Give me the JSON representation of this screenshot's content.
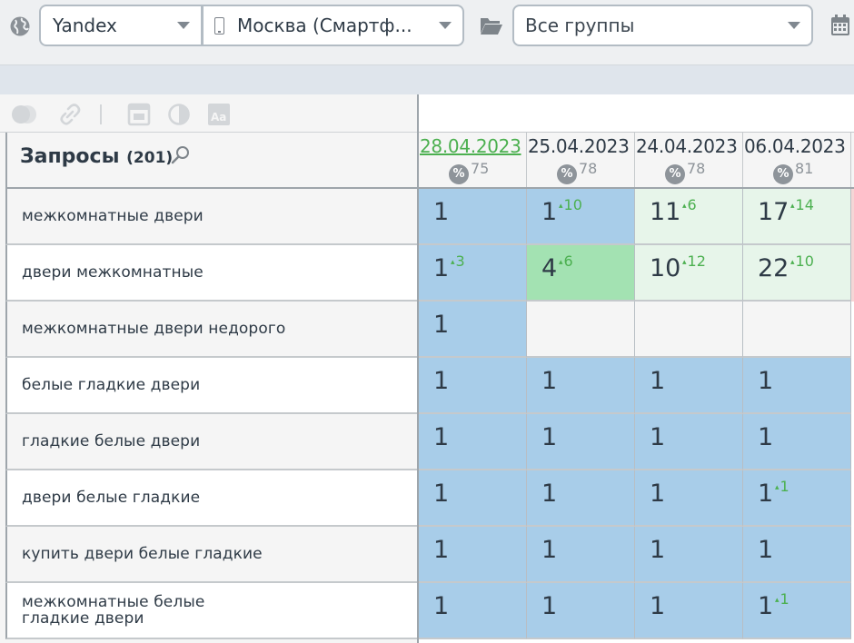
{
  "toolbar": {
    "search_engine": "Yandex",
    "region": "Москва (Смартф...",
    "group": "Все группы"
  },
  "queries": {
    "title": "Запросы",
    "count": "(201)"
  },
  "columns": [
    {
      "date": "28.04.2023",
      "metric": "75",
      "active": true
    },
    {
      "date": "25.04.2023",
      "metric": "78",
      "active": false
    },
    {
      "date": "24.04.2023",
      "metric": "78",
      "active": false
    },
    {
      "date": "06.04.2023",
      "metric": "81",
      "active": false
    }
  ],
  "percent_symbol": "%",
  "rows": [
    {
      "query": "межкомнатные двери",
      "cells": [
        {
          "value": "1",
          "delta": "",
          "color": "blue"
        },
        {
          "value": "1",
          "delta": "10",
          "color": "blue"
        },
        {
          "value": "11",
          "delta": "6",
          "color": "lightgreen"
        },
        {
          "value": "17",
          "delta": "14",
          "color": "lightgreen"
        }
      ]
    },
    {
      "query": "двери межкомнатные",
      "cells": [
        {
          "value": "1",
          "delta": "3",
          "color": "blue"
        },
        {
          "value": "4",
          "delta": "6",
          "color": "green"
        },
        {
          "value": "10",
          "delta": "12",
          "color": "lightgreen"
        },
        {
          "value": "22",
          "delta": "10",
          "color": "lightgreen"
        }
      ]
    },
    {
      "query": "межкомнатные двери недорого",
      "cells": [
        {
          "value": "1",
          "delta": "",
          "color": "blue"
        },
        {
          "value": "",
          "delta": "",
          "color": "white"
        },
        {
          "value": "",
          "delta": "",
          "color": "white"
        },
        {
          "value": "",
          "delta": "",
          "color": "white"
        }
      ]
    },
    {
      "query": "белые гладкие двери",
      "cells": [
        {
          "value": "1",
          "delta": "",
          "color": "blue"
        },
        {
          "value": "1",
          "delta": "",
          "color": "blue"
        },
        {
          "value": "1",
          "delta": "",
          "color": "blue"
        },
        {
          "value": "1",
          "delta": "",
          "color": "blue"
        }
      ]
    },
    {
      "query": "гладкие белые двери",
      "cells": [
        {
          "value": "1",
          "delta": "",
          "color": "blue"
        },
        {
          "value": "1",
          "delta": "",
          "color": "blue"
        },
        {
          "value": "1",
          "delta": "",
          "color": "blue"
        },
        {
          "value": "1",
          "delta": "",
          "color": "blue"
        }
      ]
    },
    {
      "query": "двери белые гладкие",
      "cells": [
        {
          "value": "1",
          "delta": "",
          "color": "blue"
        },
        {
          "value": "1",
          "delta": "",
          "color": "blue"
        },
        {
          "value": "1",
          "delta": "",
          "color": "blue"
        },
        {
          "value": "1",
          "delta": "1",
          "color": "blue"
        }
      ]
    },
    {
      "query": "купить двери белые гладкие",
      "cells": [
        {
          "value": "1",
          "delta": "",
          "color": "blue"
        },
        {
          "value": "1",
          "delta": "",
          "color": "blue"
        },
        {
          "value": "1",
          "delta": "",
          "color": "blue"
        },
        {
          "value": "1",
          "delta": "",
          "color": "blue"
        }
      ]
    },
    {
      "query": "межкомнатные белые гладкие двери",
      "cells": [
        {
          "value": "1",
          "delta": "",
          "color": "blue"
        },
        {
          "value": "1",
          "delta": "",
          "color": "blue"
        },
        {
          "value": "1",
          "delta": "",
          "color": "blue"
        },
        {
          "value": "1",
          "delta": "1",
          "color": "blue"
        }
      ]
    }
  ],
  "icons": {
    "region_device": "smartphone-icon",
    "globe": "globe-icon",
    "folder": "folder-icon",
    "calendar": "calendar-icon",
    "search": "search-icon",
    "toggle": "toggle-icon",
    "link": "link-icon",
    "window": "window-icon",
    "contrast": "contrast-icon",
    "font": "font-size-icon"
  },
  "colors": {
    "blue": "#a8cde9",
    "green": "#a3e2b2",
    "lightgreen": "#e7f5ea",
    "accent": "#4cb050"
  }
}
